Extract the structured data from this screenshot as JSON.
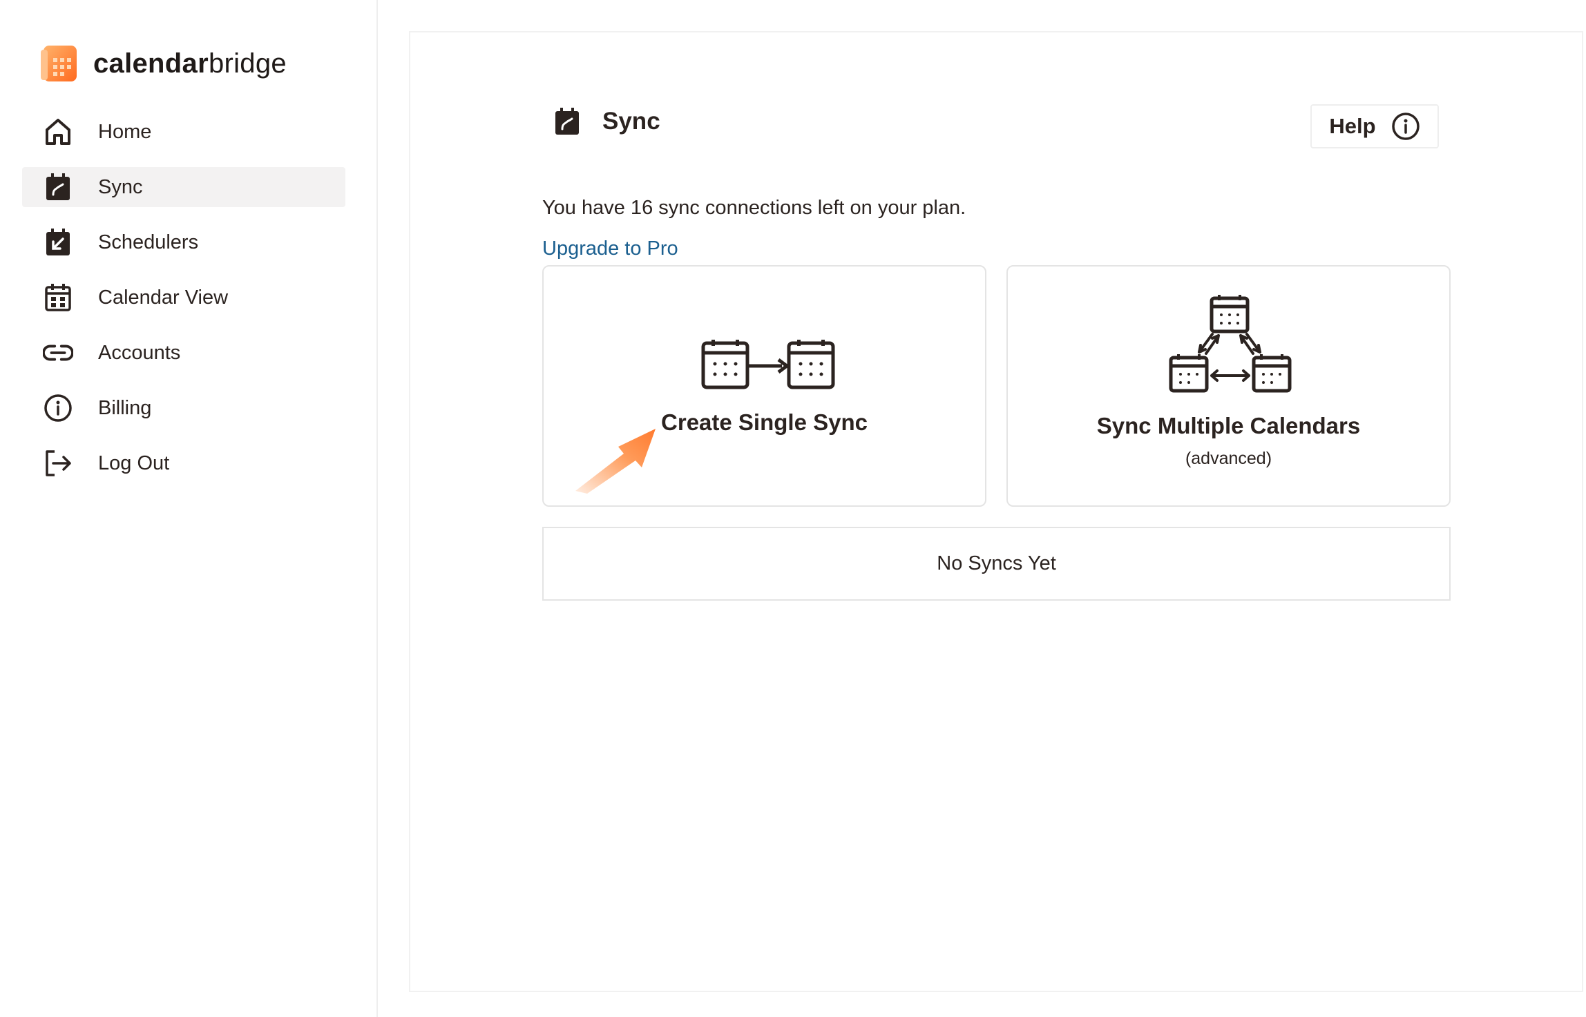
{
  "brand": {
    "name_bold": "calendar",
    "name_light": "bridge"
  },
  "sidebar": {
    "items": [
      {
        "label": "Home",
        "icon": "home-icon"
      },
      {
        "label": "Sync",
        "icon": "sync-calendar-icon",
        "active": true
      },
      {
        "label": "Schedulers",
        "icon": "scheduler-icon"
      },
      {
        "label": "Calendar View",
        "icon": "calendar-icon"
      },
      {
        "label": "Accounts",
        "icon": "link-icon"
      },
      {
        "label": "Billing",
        "icon": "info-icon"
      },
      {
        "label": "Log Out",
        "icon": "logout-icon"
      }
    ]
  },
  "header": {
    "title": "Sync",
    "help_label": "Help"
  },
  "plan": {
    "message": "You have 16 sync connections left on your plan.",
    "upgrade_label": "Upgrade to Pro"
  },
  "cards": {
    "single": {
      "title": "Create Single Sync"
    },
    "multi": {
      "title": "Sync Multiple Calendars",
      "subtitle": "(advanced)"
    }
  },
  "syncs": {
    "empty_label": "No Syncs Yet"
  },
  "colors": {
    "brand": "#ff7a2f",
    "link": "#1b5f8f",
    "icon_dark": "#2b2320"
  }
}
